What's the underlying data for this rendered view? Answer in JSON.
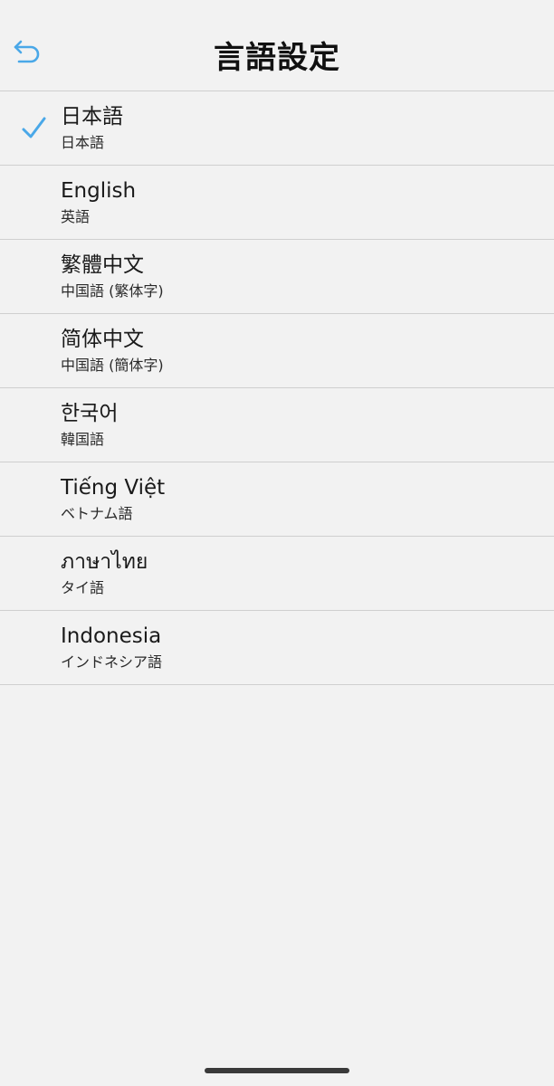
{
  "header": {
    "title": "言語設定",
    "back_icon": "undo-arrow-icon"
  },
  "colors": {
    "accent": "#4aa8e8",
    "background": "#f2f2f2",
    "divider": "#cfcfcf"
  },
  "languages": [
    {
      "name": "日本語",
      "sub": "日本語",
      "selected": true
    },
    {
      "name": "English",
      "sub": "英語",
      "selected": false
    },
    {
      "name": "繁體中文",
      "sub": "中国語 (繁体字)",
      "selected": false
    },
    {
      "name": "简体中文",
      "sub": "中国語 (簡体字)",
      "selected": false
    },
    {
      "name": "한국어",
      "sub": "韓国語",
      "selected": false
    },
    {
      "name": "Tiếng Việt",
      "sub": "ベトナム語",
      "selected": false
    },
    {
      "name": "ภาษาไทย",
      "sub": "タイ語",
      "selected": false
    },
    {
      "name": "Indonesia",
      "sub": "インドネシア語",
      "selected": false
    }
  ]
}
